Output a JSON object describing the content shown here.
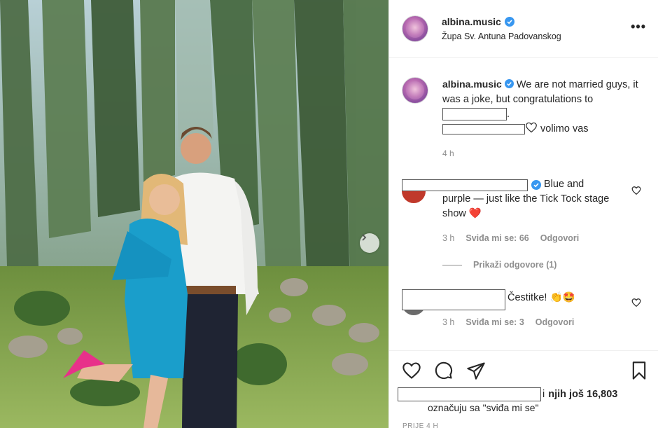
{
  "post": {
    "username": "albina.music",
    "location": "Župa Sv. Antuna Padovanskog",
    "more_label": "•••"
  },
  "caption": {
    "username": "albina.music",
    "text_1": "We are not married guys, it was a joke, but congratulations to",
    "text_2": ".",
    "text_3": "volimo vas",
    "time": "4 h"
  },
  "comments": [
    {
      "text": "Blue and purple — just like the Tick Tock stage show",
      "emoji": "❤️",
      "time": "3 h",
      "likes": "Sviđa mi se: 66",
      "reply": "Odgovori"
    },
    {
      "text": "Čestitke!",
      "emoji": "👏🤩",
      "time": "3 h",
      "likes": "Sviđa mi se: 3",
      "reply": "Odgovori"
    }
  ],
  "view_replies": "Prikaži odgovore (1)",
  "likes": {
    "prefix": "i",
    "others": "njih još 16,803",
    "suffix": "označuju sa \"sviđa mi se\""
  },
  "post_time": "PRIJE 4 H",
  "colors": {
    "verified": "#3897f0",
    "heart": "#ed4956",
    "muted": "#8e8e8e"
  }
}
